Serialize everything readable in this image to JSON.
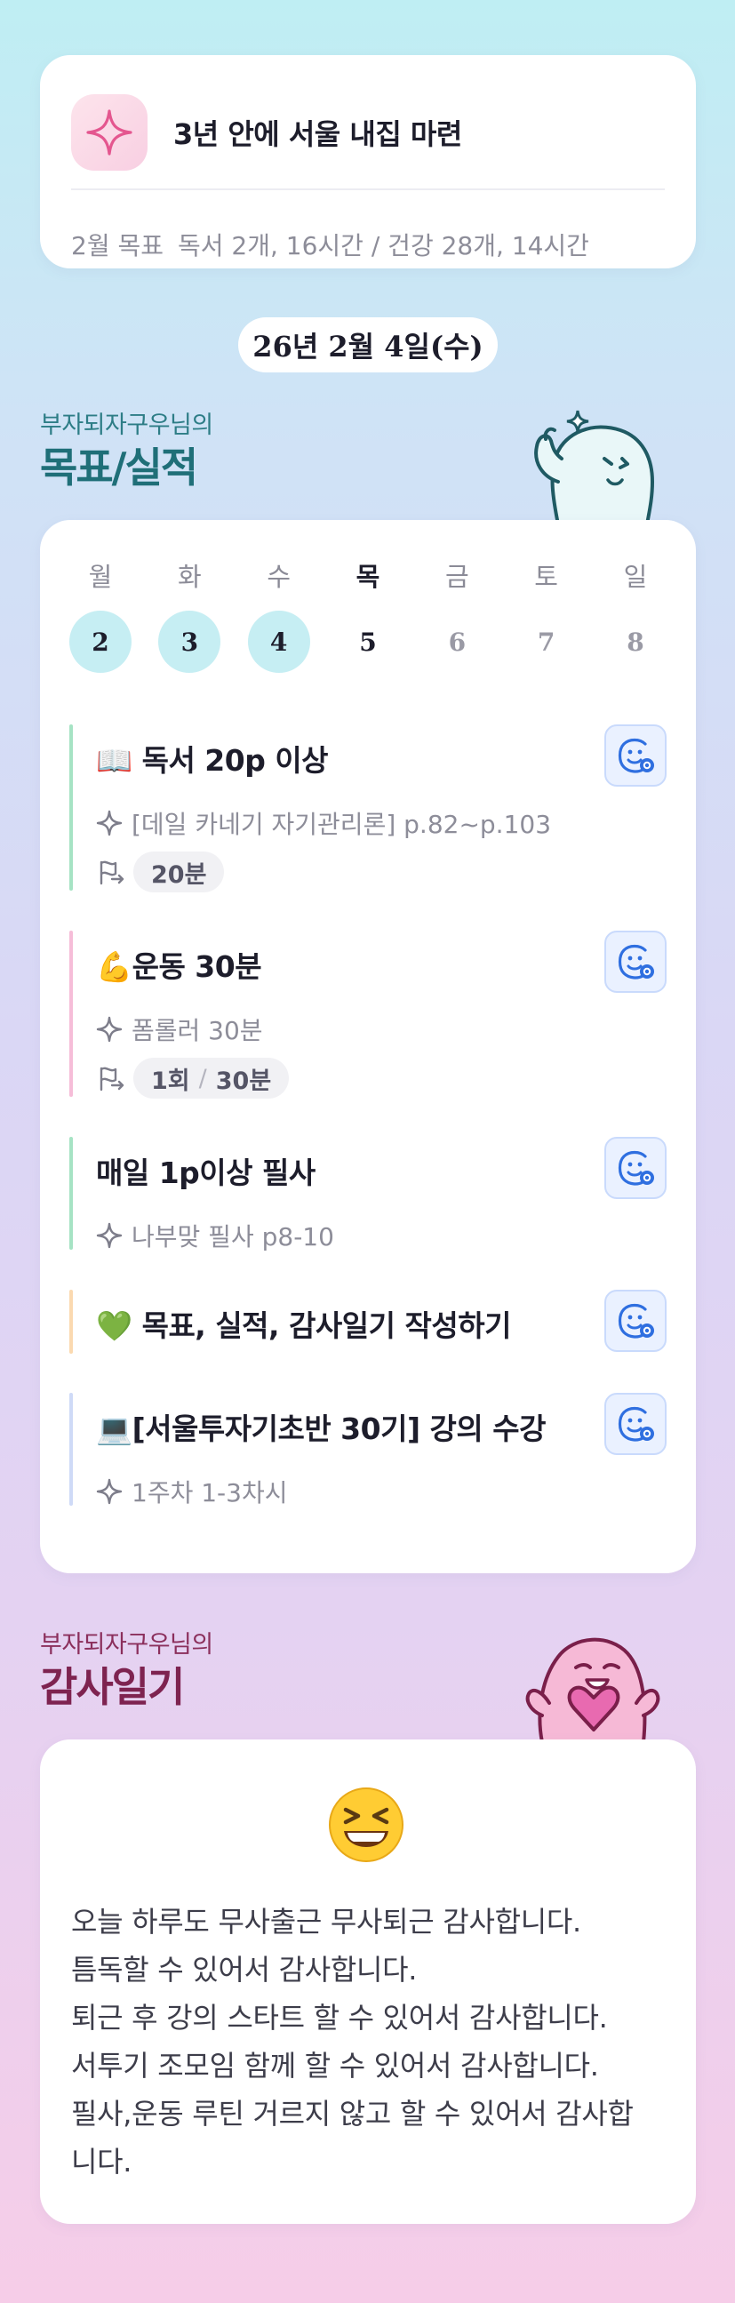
{
  "goal": {
    "title": "3년 안에 서울 내집 마련",
    "month_label": "2월 목표",
    "month_goals": "독서 2개, 16시간 / 건강 28개, 14시간"
  },
  "date": "26년 2월 4일(수)",
  "goals_section": {
    "subtitle": "부자되자구우님의",
    "title": "목표/실적"
  },
  "week": [
    {
      "day": "월",
      "date": "2",
      "state": "done"
    },
    {
      "day": "화",
      "date": "3",
      "state": "done"
    },
    {
      "day": "수",
      "date": "4",
      "state": "done"
    },
    {
      "day": "목",
      "date": "5",
      "state": "today"
    },
    {
      "day": "금",
      "date": "6",
      "state": "future"
    },
    {
      "day": "토",
      "date": "7",
      "state": "future"
    },
    {
      "day": "일",
      "date": "8",
      "state": "future"
    }
  ],
  "tasks": [
    {
      "title": "📖 독서 20p 이상",
      "subtitle": "[데일 카네기 자기관리론] p.82~p.103",
      "time": "20분",
      "color": "#a6e3c4"
    },
    {
      "title": "💪운동 30분",
      "subtitle": "폼롤러 30분",
      "count": "1회",
      "time": "30분",
      "color": "#f6bdd8"
    },
    {
      "title": "매일 1p이상 필사",
      "subtitle": "나부맞 필사 p8-10",
      "color": "#a6e3c4"
    },
    {
      "title": "💚 목표, 실적, 감사일기 작성하기",
      "color": "#fbd9b0"
    },
    {
      "title": "💻[서울투자기초반 30기] 강의 수강",
      "subtitle": "1주차 1-3차시",
      "color": "#cfdaf7"
    }
  ],
  "gratitude_section": {
    "subtitle": "부자되자구우님의",
    "title": "감사일기"
  },
  "gratitude": {
    "emoji": "😆",
    "lines": [
      "오늘 하루도 무사출근 무사퇴근 감사합니다.",
      "틈독할 수 있어서 감사합니다.",
      "퇴근 후 강의 스타트 할 수 있어서 감사합니다.",
      "서투기 조모임 함께 할 수 있어서 감사합니다.",
      "필사,운동 루틴 거르지 않고 할 수 있어서 감사합",
      "니다."
    ]
  },
  "icons": {
    "goal": "sparkle-icon",
    "task_button": "smile-check-icon",
    "task_detail": "sparkle-icon",
    "task_time": "flag-icon"
  },
  "colors": {
    "accent_teal": "#1f6f78",
    "accent_berry": "#7e2350",
    "done_day": "#c6eef3",
    "button_blue": "#2f6fe0"
  }
}
